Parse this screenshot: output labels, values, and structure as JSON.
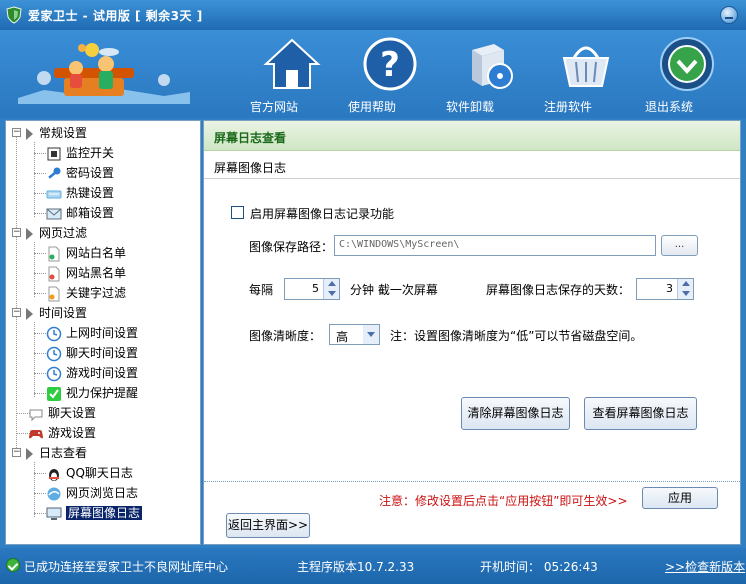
{
  "window": {
    "title": "爱家卫士 - 试用版 [ 剩余3天 ]",
    "minimize_icon": "minimize-icon"
  },
  "nav": [
    {
      "label": "官方网站",
      "icon": "home-icon"
    },
    {
      "label": "使用帮助",
      "icon": "help-icon"
    },
    {
      "label": "软件卸载",
      "icon": "uninstall-icon"
    },
    {
      "label": "注册软件",
      "icon": "basket-icon"
    },
    {
      "label": "退出系统",
      "icon": "exit-icon"
    }
  ],
  "tree": {
    "groups": [
      {
        "label": "常规设置",
        "children": [
          "监控开关",
          "密码设置",
          "热键设置",
          "邮箱设置"
        ]
      },
      {
        "label": "网页过滤",
        "children": [
          "网站白名单",
          "网站黑名单",
          "关键字过滤"
        ]
      },
      {
        "label": "时间设置",
        "children": [
          "上网时间设置",
          "聊天时间设置",
          "游戏时间设置",
          "视力保护提醒"
        ]
      },
      {
        "label": "聊天设置",
        "children": []
      },
      {
        "label": "游戏设置",
        "children": []
      },
      {
        "label": "日志查看",
        "children": [
          "QQ聊天日志",
          "网页浏览日志",
          "屏幕图像日志"
        ]
      }
    ],
    "selected": "屏幕图像日志"
  },
  "main": {
    "header": "屏幕日志查看",
    "subtitle": "屏幕图像日志",
    "enable_label": "启用屏幕图像日志记录功能",
    "enable_checked": false,
    "path_label": "图像保存路径：",
    "path_value": "C:\\WINDOWS\\MyScreen\\",
    "browse_label": "...",
    "every_label": "每隔",
    "interval_value": "5",
    "interval_suffix": "分钟  截一次屏幕",
    "days_label": "屏幕图像日志保存的天数：",
    "days_value": "3",
    "clarity_label": "图像清晰度：",
    "clarity_value": "高",
    "clarity_note": "注：设置图像清晰度为“低”可以节省磁盘空间。",
    "clear_button": "清除屏幕图像日志",
    "view_button": "查看屏幕图像日志",
    "apply_note": "注意：修改设置后点击“应用按钮”即可生效>>",
    "apply_button": "应用",
    "back_button": "返回主界面>>"
  },
  "status": {
    "connection": "已成功连接至爱家卫士不良网址库中心",
    "version": "主程序版本10.7.2.33",
    "boot_time": "开机时间： 05:26:43",
    "check_update": ">>检查新版本"
  },
  "colors": {
    "brand_blue": "#2a78c0",
    "header_green": "#1d6a1d",
    "note_red": "#cc1111"
  }
}
